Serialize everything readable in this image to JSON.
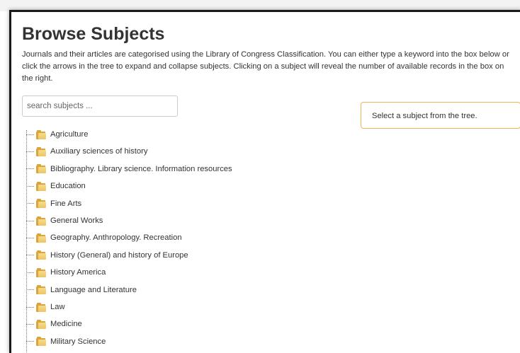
{
  "page": {
    "title": "Browse Subjects",
    "intro": "Journals and their articles are categorised using the Library of Congress Classification. You can either type a keyword into the box below or click the arrows in the tree to expand and collapse subjects. Clicking on a subject will reveal the number of available records in the box on the right."
  },
  "search": {
    "placeholder": "search subjects ...",
    "value": ""
  },
  "info_box": {
    "text": "Select a subject from the tree."
  },
  "tree": {
    "items": [
      {
        "label": "Agriculture",
        "icon": "folder-icon"
      },
      {
        "label": "Auxiliary sciences of history",
        "icon": "folder-icon"
      },
      {
        "label": "Bibliography. Library science. Information resources",
        "icon": "folder-icon"
      },
      {
        "label": "Education",
        "icon": "folder-icon"
      },
      {
        "label": "Fine Arts",
        "icon": "folder-icon"
      },
      {
        "label": "General Works",
        "icon": "folder-icon"
      },
      {
        "label": "Geography. Anthropology. Recreation",
        "icon": "folder-icon"
      },
      {
        "label": "History (General) and history of Europe",
        "icon": "folder-icon"
      },
      {
        "label": "History America",
        "icon": "folder-icon"
      },
      {
        "label": "Language and Literature",
        "icon": "folder-icon"
      },
      {
        "label": "Law",
        "icon": "folder-icon"
      },
      {
        "label": "Medicine",
        "icon": "folder-icon"
      },
      {
        "label": "Military Science",
        "icon": "folder-icon"
      }
    ]
  },
  "colors": {
    "info_box_border": "#f0b456",
    "folder": "#eec563",
    "panel_border": "#1a1a1a"
  }
}
